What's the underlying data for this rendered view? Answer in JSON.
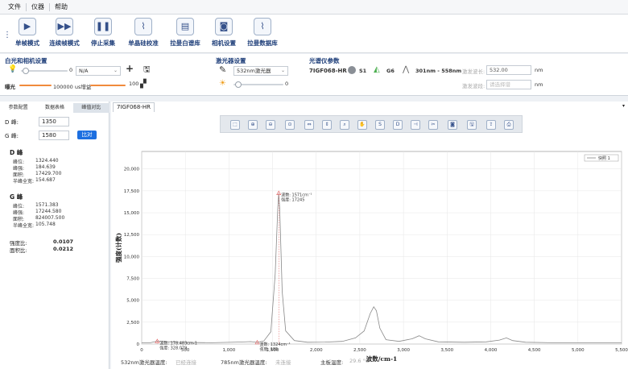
{
  "menu": [
    "文件",
    "仪器",
    "帮助"
  ],
  "toolbar": [
    {
      "label": "单帧模式",
      "icon": "play-icon",
      "glyph": "▶"
    },
    {
      "label": "连续帧模式",
      "icon": "fast-forward-icon",
      "glyph": "▶▶"
    },
    {
      "label": "停止采集",
      "icon": "pause-icon",
      "glyph": "❚❚"
    },
    {
      "label": "单晶硅校准",
      "icon": "spectrum-icon",
      "glyph": "⌇"
    },
    {
      "label": "拉曼白谱库",
      "icon": "library-icon",
      "glyph": "▤"
    },
    {
      "label": "相机设置",
      "icon": "camera-icon",
      "glyph": "◙"
    },
    {
      "label": "拉曼数据库",
      "icon": "database-icon",
      "glyph": "⌇"
    }
  ],
  "white_light": {
    "title": "白光和相机设置",
    "light_value": "0",
    "na_label": "N/A",
    "exposure_label": "曝光",
    "exposure_value": "100000 us增益",
    "gain_value": "100"
  },
  "laser": {
    "title": "激光器设置",
    "laser_select": "532nm激光器",
    "power_value": "0"
  },
  "spectrometer": {
    "title": "光谱仪参数",
    "model": "7IGF068-HR",
    "s1": "S1",
    "g6": "G6",
    "range": "301nm - 558nm",
    "center_label": "激发波长:",
    "center_value": "532.00",
    "center_unit": "nm",
    "extra_label": "激发波段:",
    "extra_placeholder": "请选择谱",
    "extra_unit": "nm"
  },
  "left_panel": {
    "tabs": [
      "参数配置",
      "数据表格",
      "峰值对比"
    ],
    "d_label": "D 峰:",
    "d_value": "1350",
    "g_label": "G 峰:",
    "g_value": "1580",
    "calc_label": "比对",
    "d_peak": {
      "title": "D 峰",
      "pos_label": "峰位:",
      "pos": "1324.440",
      "fwhm_label": "峰强:",
      "fwhm": "184.639",
      "area_label": "面积:",
      "area": "17429.700",
      "half_label": "半峰全宽:",
      "half": "154.687"
    },
    "g_peak": {
      "title": "G 峰",
      "pos_label": "峰位:",
      "pos": "1571.383",
      "fwhm_label": "峰强:",
      "fwhm": "17244.580",
      "area_label": "面积:",
      "area": "824007.500",
      "half_label": "半峰全宽:",
      "half": "105.748"
    },
    "intensity_ratio_label": "强度比:",
    "intensity_ratio": "0.0107",
    "area_ratio_label": "面积比:",
    "area_ratio": "0.0212"
  },
  "chart_tab": "7IGF068-HR",
  "chart_toolbar_icons": [
    "select-icon",
    "zoom-in-icon",
    "zoom-out-icon",
    "fit-icon",
    "zoom-x-icon",
    "zoom-y-icon",
    "zoom-box-icon",
    "pan-icon",
    "s-icon",
    "d-icon",
    "mark-icon",
    "cut-icon",
    "photo-icon",
    "save-icon",
    "export-icon",
    "print-icon"
  ],
  "chart_data": {
    "type": "line",
    "xlabel": "波数/cm-1",
    "ylabel": "强度(计数)",
    "xlim": [
      0,
      5500
    ],
    "ylim": [
      0,
      22000
    ],
    "x_ticks": [
      0,
      500,
      1000,
      1500,
      2000,
      2500,
      3000,
      3500,
      4000,
      4500,
      5000,
      5500
    ],
    "x_tick_labels": [
      "0",
      "500",
      "1,000",
      "1,500",
      "2,000",
      "2,500",
      "3,000",
      "3,500",
      "4,000",
      "4,500",
      "5,000",
      "5,500"
    ],
    "y_ticks": [
      0,
      2500,
      5000,
      7500,
      10000,
      12500,
      15000,
      17500,
      20000
    ],
    "y_tick_labels": [
      "0",
      "2,500",
      "5,000",
      "7,500",
      "10,000",
      "12,500",
      "15,000",
      "17,500",
      "20,000"
    ],
    "legend": "快照 1",
    "grid": true,
    "series": [
      {
        "x": [
          0,
          100,
          178,
          400,
          800,
          1100,
          1250,
          1324,
          1400,
          1480,
          1530,
          1560,
          1571,
          1582,
          1610,
          1650,
          1750,
          1900,
          2100,
          2300,
          2450,
          2550,
          2620,
          2660,
          2690,
          2730,
          2800,
          2950,
          3100,
          3180,
          3250,
          3400,
          3700,
          3950,
          4100,
          4180,
          4250,
          4400,
          4700,
          5000,
          5300,
          5500
        ],
        "y": [
          150,
          150,
          328,
          200,
          150,
          220,
          280,
          185,
          350,
          1400,
          8000,
          15500,
          17245,
          15500,
          6000,
          1500,
          400,
          200,
          220,
          300,
          700,
          1500,
          3500,
          4250,
          3800,
          1800,
          500,
          300,
          600,
          950,
          600,
          250,
          200,
          250,
          450,
          700,
          400,
          200,
          150,
          150,
          150,
          150
        ],
        "color": "#888888"
      }
    ],
    "markers": [
      {
        "x": 178.483,
        "y": 328.079,
        "label1": "波数: 178.483cm-1",
        "label2": "强度: 328.079",
        "line_color": "#e05a5a"
      },
      {
        "x": 1324,
        "y": 185,
        "label1": "波数: 1324cm⁻¹",
        "label2": "强度: 185",
        "line_color": "#e05a5a"
      },
      {
        "x": 1571,
        "y": 17245,
        "label1": "波数: 1571cm⁻¹",
        "label2": "强度: 17245",
        "line_color": "#e05a5a"
      }
    ]
  },
  "footer": {
    "laser532_label": "532nm激光器温度:",
    "laser532_value": "已经连接",
    "laser785_label": "785nm激光器温度:",
    "laser785_value": "未连接",
    "board_label": "主板温度:",
    "board_value": "29.6 °C"
  }
}
